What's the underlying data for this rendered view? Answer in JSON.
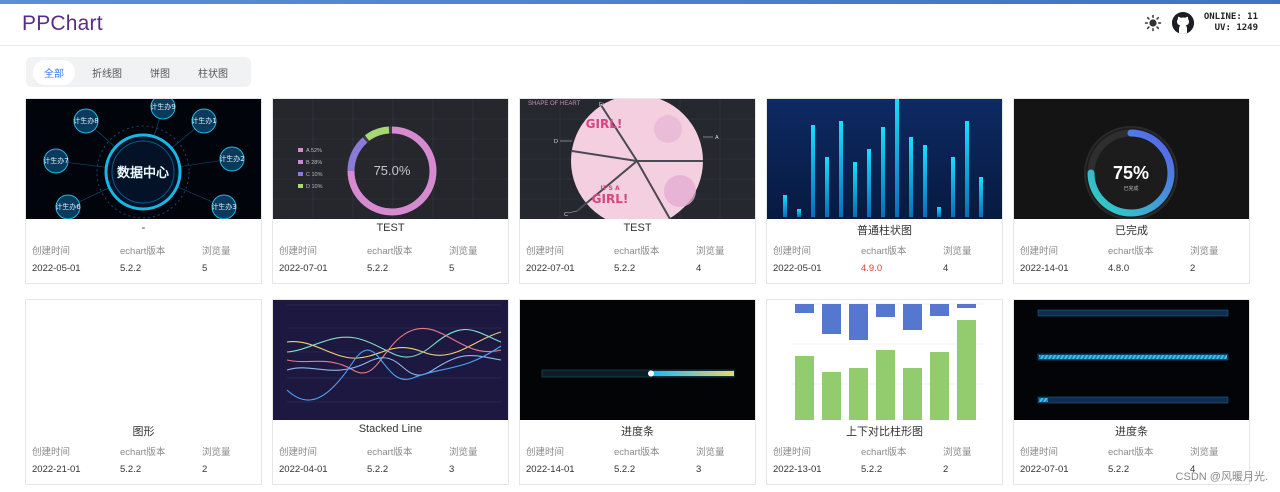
{
  "header": {
    "logo": "PPChart",
    "stats_online": "ONLINE: 11",
    "stats_uv": "UV: 1249"
  },
  "filter": {
    "tabs": [
      "全部",
      "折线图",
      "饼图",
      "柱状图"
    ],
    "active_index": 0
  },
  "meta_labels": {
    "created": "创建时间",
    "version": "echart版本",
    "views": "浏览量"
  },
  "cards": [
    {
      "title": "-",
      "created": "2022-05-01",
      "version": "5.2.2",
      "views": "5",
      "thumb": "data-center"
    },
    {
      "title": "TEST",
      "created": "2022-07-01",
      "version": "5.2.2",
      "views": "5",
      "thumb": "ring-75"
    },
    {
      "title": "TEST",
      "created": "2022-07-01",
      "version": "5.2.2",
      "views": "4",
      "thumb": "heart-pie"
    },
    {
      "title": "普通柱状图",
      "created": "2022-05-01",
      "version": "4.9.0",
      "views": "4",
      "thumb": "bar-blue",
      "version_highlight": true
    },
    {
      "title": "已完成",
      "created": "2022-14-01",
      "version": "4.8.0",
      "views": "2",
      "thumb": "gauge-75"
    },
    {
      "title": "图形",
      "created": "2022-21-01",
      "version": "5.2.2",
      "views": "2",
      "thumb": "blank"
    },
    {
      "title": "Stacked Line",
      "created": "2022-04-01",
      "version": "5.2.2",
      "views": "3",
      "thumb": "stacked-line"
    },
    {
      "title": "进度条",
      "created": "2022-14-01",
      "version": "5.2.2",
      "views": "3",
      "thumb": "progress-dark"
    },
    {
      "title": "上下对比柱形图",
      "created": "2022-13-01",
      "version": "5.2.2",
      "views": "2",
      "thumb": "updown-bar"
    },
    {
      "title": "进度条",
      "created": "2022-07-01",
      "version": "5.2.2",
      "views": "4",
      "thumb": "progress-bars"
    }
  ],
  "thumb_text": {
    "data_center": "数据中心",
    "data_center_nodes": [
      "计生办9",
      "计生办1",
      "计生办2",
      "计生办3",
      "计生办6",
      "计生办7",
      "计生办8"
    ],
    "ring_center": "75.0%",
    "ring_legend": [
      "A 52%",
      "B 28%",
      "C 10%",
      "D 10%"
    ],
    "heart_title": "SHAPE OF HEART",
    "heart_words": [
      "GIRL!",
      "IT'S A",
      "GIRL!"
    ],
    "heart_labels": [
      "E",
      "D",
      "A",
      "C"
    ],
    "gauge_value": "75%",
    "gauge_sub": "已完成"
  },
  "watermark": "CSDN @风暖月光."
}
